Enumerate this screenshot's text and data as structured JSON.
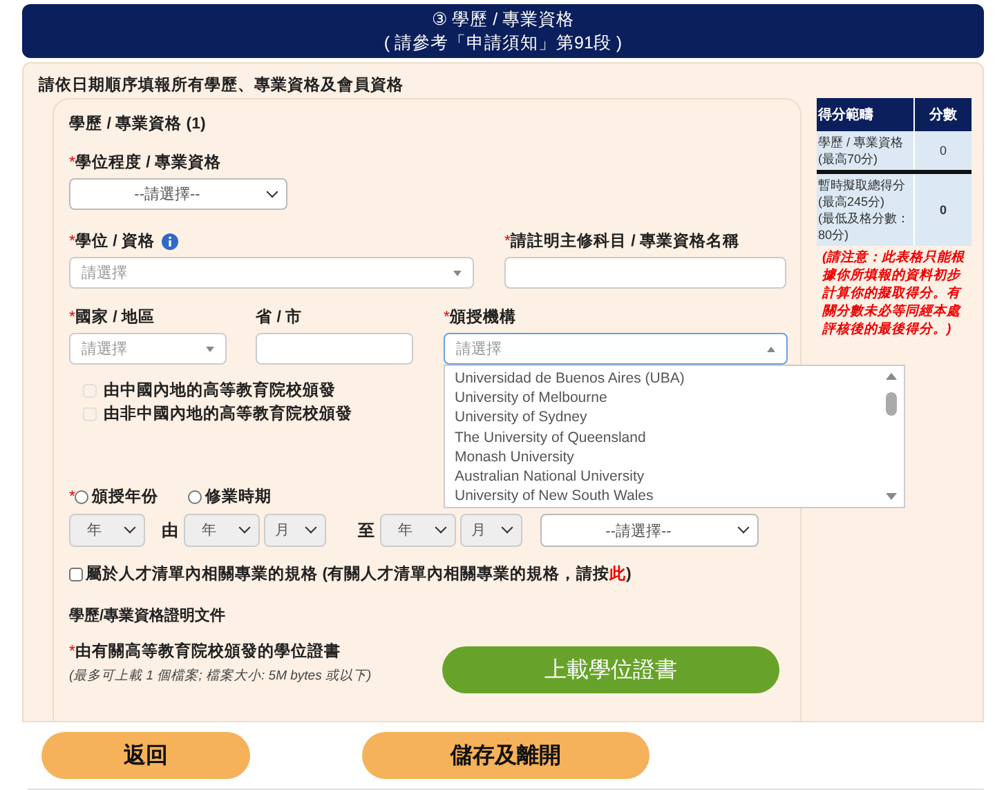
{
  "header": {
    "step": "③ 學歷 / 專業資格",
    "reference": "( 請參考「申請須知」第91段 )"
  },
  "instruction": "請依日期順序填報所有學歷、專業資格及會員資格",
  "form_title": "學歷 / 專業資格 (1)",
  "degree_level": {
    "marker": "*",
    "label": "學位程度 / 專業資格",
    "value": "--請選擇--"
  },
  "degree": {
    "marker": "*",
    "label": "學位 / 資格",
    "placeholder": "請選擇"
  },
  "major": {
    "marker": "*",
    "label": "請註明主修科目 / 專業資格名稱"
  },
  "country": {
    "marker": "*",
    "label": "國家 / 地區",
    "placeholder": "請選擇"
  },
  "province": {
    "label": "省 / 市"
  },
  "institution": {
    "marker": "*",
    "label": "頒授機構",
    "placeholder": "請選擇",
    "expanded": true,
    "options": [
      "Universidad de Buenos Aires (UBA)",
      "University of Melbourne",
      "University of Sydney",
      "The University of Queensland",
      "Monash University",
      "Australian National University",
      "University of New South Wales"
    ]
  },
  "issuer_checkboxes": [
    {
      "label": "由中國內地的高等教育院校頒發",
      "checked": false,
      "disabled": true
    },
    {
      "label": "由非中國內地的高等教育院校頒發",
      "checked": false,
      "disabled": true
    }
  ],
  "date_type": {
    "marker": "*",
    "options": [
      {
        "label": "頒授年份",
        "selected": false
      },
      {
        "label": "修業時期",
        "selected": false
      }
    ]
  },
  "date_row": [
    {
      "kind": "select",
      "value": "年"
    },
    {
      "kind": "connector",
      "text": "由"
    },
    {
      "kind": "select",
      "value": "年"
    },
    {
      "kind": "small_select",
      "value": "月"
    },
    {
      "kind": "connector",
      "text": "至"
    },
    {
      "kind": "select",
      "value": "年"
    },
    {
      "kind": "small_select",
      "value": "月"
    },
    {
      "kind": "wide_select",
      "value": "--請選擇--"
    }
  ],
  "talent_list": {
    "checked": false,
    "text_before": "屬於人才清單內相關專業的規格 (有關人才清單內相關專業的規格，請按",
    "link": "此",
    "text_after": ")"
  },
  "documents": {
    "title": "學歷/專業資格證明文件",
    "marker": "*",
    "label": "由有關高等教育院校頒發的學位證書",
    "hint": "(最多可上載 1 個檔案; 檔案大小: 5M bytes 或以下)",
    "upload_button": "上載學位證書"
  },
  "score_table": {
    "columns": [
      "得分範疇",
      "分數"
    ],
    "rows": [
      {
        "lines": [
          "學歷 / 專業資格",
          "(最高70分)"
        ],
        "score": "0",
        "bold": false
      },
      {
        "lines": [
          "暫時擬取總得分",
          "(最高245分)",
          "(最低及格分數：80分)"
        ],
        "score": "0",
        "bold": true
      }
    ],
    "note": "(請注意：此表格只能根據你所填報的資料初步計算你的擬取得分。有關分數未必等同經本處評核後的最後得分。)"
  },
  "buttons": [
    {
      "label": "返回"
    },
    {
      "label": "儲存及離開"
    }
  ]
}
